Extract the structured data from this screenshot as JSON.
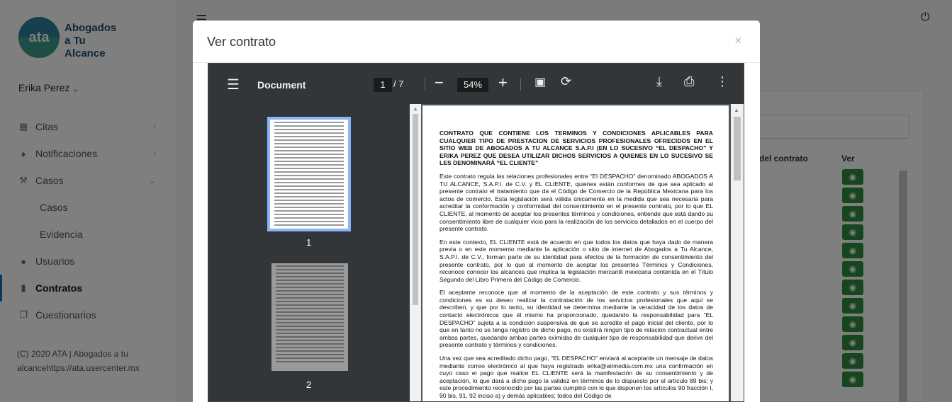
{
  "sidebar": {
    "logo_text": "ata",
    "brand_lines": [
      "Abogados",
      "a Tu",
      "Alcance"
    ],
    "user_name": "Erika Perez",
    "items": [
      {
        "label": "Citas",
        "icon": "calendar-icon"
      },
      {
        "label": "Notificaciones",
        "icon": "bell-icon"
      },
      {
        "label": "Casos",
        "icon": "gavel-icon"
      },
      {
        "label": "Casos",
        "icon": ""
      },
      {
        "label": "Evidencia",
        "icon": ""
      },
      {
        "label": "Usuarios",
        "icon": "users-icon"
      },
      {
        "label": "Contratos",
        "icon": "file-icon"
      },
      {
        "label": "Cuestionarios",
        "icon": "copy-icon"
      }
    ],
    "footer": "(C) 2020 ATA | Abogados a tu alcancehttps://ata.usercenter.mx"
  },
  "background_table": {
    "col_contract": "del contrato",
    "col_view": "Ver"
  },
  "modal": {
    "title": "Ver contrato",
    "close": "×"
  },
  "pdf": {
    "title": "Document",
    "current_page": "1",
    "total_pages": "/ 7",
    "zoom": "54%",
    "thumb_labels": [
      "1",
      "2"
    ],
    "page_text": {
      "heading": "CONTRATO QUE CONTIENE LOS TERMINOS Y CONDICIONES APLICABLES PARA CUALQUIER TIPO DE PRESTACION DE SERVICIOS PROFESIONALES OFRECIDOS EN EL SITIO WEB DE ABOGADOS A TU ALCANCE S.A.P.I (EN LO SUCESIVO “EL DESPACHO” Y ERIKA PEREZ QUE DESEA UTILIZAR DICHOS SERVICIOS A QUIENES EN LO SUCESIVO SE LES DENOMINARÁ “EL CLIENTE”",
      "p1": "Este contrato regula las relaciones profesionales entre “El DESPACHO” denominado ABOGADOS A TU ALCANCE, S.A.P.I. de C.V. y EL CLIENTE, quienes están conformes de que sea aplicado al presente contrato el tratamiento que da el Código de Comercio de la República Mexicana para los actos de comercio. Esta legislación será válida únicamente en la medida que sea necesaria para acreditar la conformación y conformidad del consentimiento en el presente contrato, por lo que EL CLIENTE, al momento de aceptar los presentes términos y condiciones, entiende que está dando su consentimiento libre de cualquier vicio para la realización de los servicios detallados en el cuerpo del presente contrato.",
      "p2": "En este contexto, EL CLIENTE está de acuerdo en que todos los datos que haya dado de manera previa o en este momento mediante la aplicación o sitio de internet de Abogados a Tu Alcance, S.A.P.I. de C.V., forman parte de su identidad para efectos de la formación de consentimiento del presente contrato, por lo que al momento de aceptar los presentes Términos y Condiciones, reconoce conocer los alcances que implica la legislación mercantil mexicana contenida en el Título Segundo del Libro Primero del Código de Comercio.",
      "p3": "El aceptante reconoce que al momento de la aceptación de este contrato y sus términos y condiciones es su deseo realizar la contratación de los servicios profesionales que aquí se describen, y que por lo tanto, su identidad se determina mediante la veracidad de los datos de contacto electrónicos que él mismo ha proporcionado, quedando la responsabilidad para “EL DESPACHO” sujeta a la condición suspensiva de que se acredite el pago inicial del cliente, por lo que en tanto no se tenga registro de dicho pago, no existirá ningún tipo de relación contractual entre ambas partes, quedando ambas partes eximidas de cualquier tipo de responsabilidad que derive del presente contrato y términos y condiciones.",
      "p4": "Una vez que sea acreditado dicho pago, “EL DESPACHO” enviará al aceptante un mensaje de datos mediante correo electrónico al que haya registrado erika@airmedia.com.mx una confirmación en cuyo caso el pago que realice EL CLIENTE será la manifestación de su consentimiento y de aceptación, lo que dará a dicho pago la validez en términos de lo dispuesto por el artículo 89 bis; y este procedimiento reconocido por las partes cumplirá con lo que disponen los artículos 90 fracción I, 90 bis, 91, 92 inciso a) y demás aplicables; todos del Código de"
    }
  }
}
